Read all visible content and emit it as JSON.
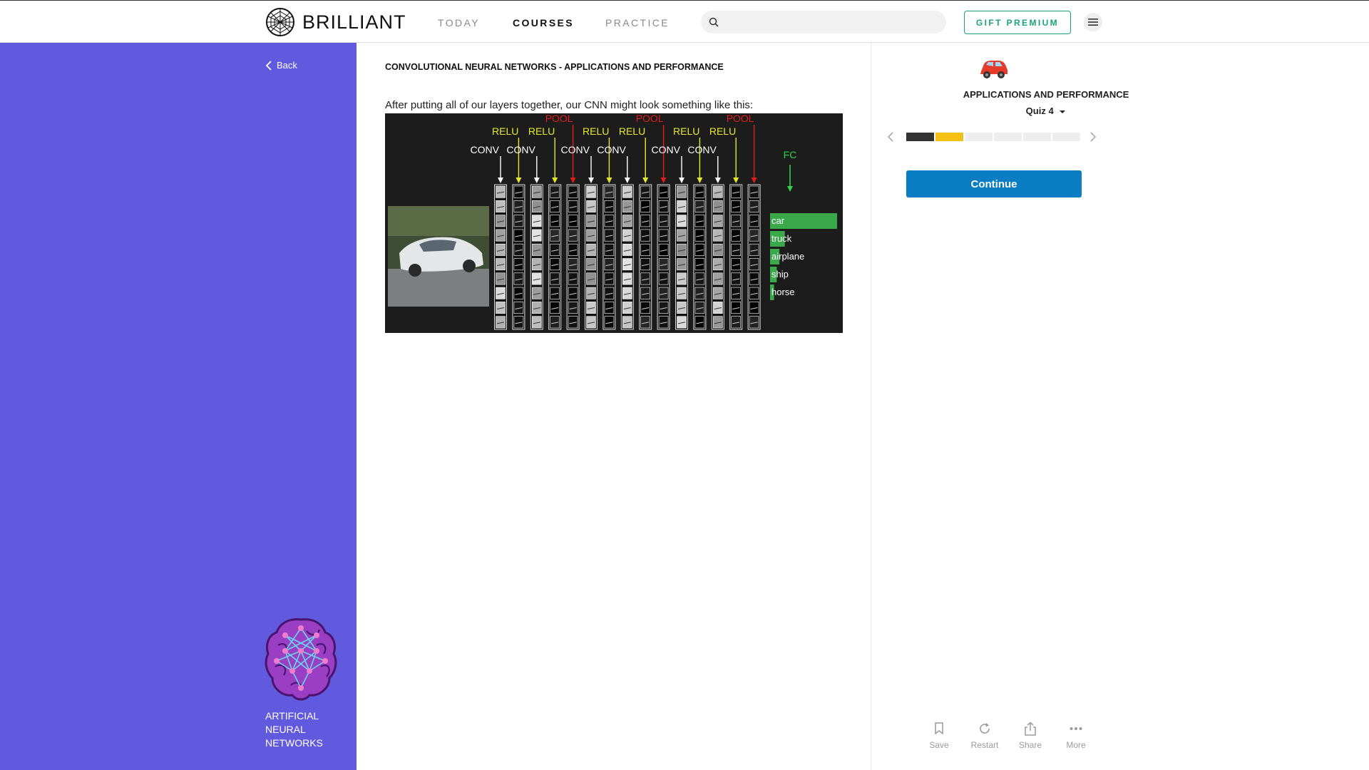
{
  "nav": {
    "brand": "BRILLIANT",
    "tabs": [
      "TODAY",
      "COURSES",
      "PRACTICE"
    ],
    "active_tab": "COURSES",
    "search_placeholder": "",
    "gift_label": "GIFT PREMIUM",
    "menu_icon": "hamburger-icon"
  },
  "sidebar": {
    "back_label": "Back",
    "course_name": "ARTIFICIAL NEURAL NETWORKS",
    "course_icon": "brain-network-icon",
    "background_color": "#6159de"
  },
  "lesson": {
    "title": "CONVOLUTIONAL NEURAL NETWORKS - APPLICATIONS AND PERFORMANCE",
    "text": "After putting all of our layers together, our CNN might look something like this:",
    "figure": {
      "layers": [
        "CONV",
        "RELU",
        "CONV",
        "RELU",
        "POOL",
        "CONV",
        "RELU",
        "CONV",
        "RELU",
        "POOL",
        "CONV",
        "RELU",
        "CONV",
        "RELU",
        "POOL"
      ],
      "fc_label": "FC",
      "classes": [
        {
          "label": "car",
          "score": 1.0
        },
        {
          "label": "truck",
          "score": 0.22
        },
        {
          "label": "airplane",
          "score": 0.14
        },
        {
          "label": "ship",
          "score": 0.1
        },
        {
          "label": "horse",
          "score": 0.06
        }
      ],
      "layer_colors": {
        "CONV": "#ffffff",
        "RELU": "#e8e82a",
        "POOL": "#e21b1b",
        "FC": "#29d44a"
      },
      "bar_color": "#3aa84b"
    }
  },
  "panel": {
    "section_title": "APPLICATIONS AND PERFORMANCE",
    "quiz_label": "Quiz 4",
    "progress": {
      "total": 6,
      "states": [
        "complete",
        "current",
        "todo",
        "todo",
        "todo",
        "todo"
      ]
    },
    "colors": {
      "complete": "#333333",
      "current": "#f5c015",
      "todo": "#eeeeee"
    },
    "continue_label": "Continue",
    "actions": [
      {
        "label": "Save",
        "icon": "bookmark-icon"
      },
      {
        "label": "Restart",
        "icon": "restart-icon"
      },
      {
        "label": "Share",
        "icon": "share-icon"
      },
      {
        "label": "More",
        "icon": "more-icon"
      }
    ]
  }
}
